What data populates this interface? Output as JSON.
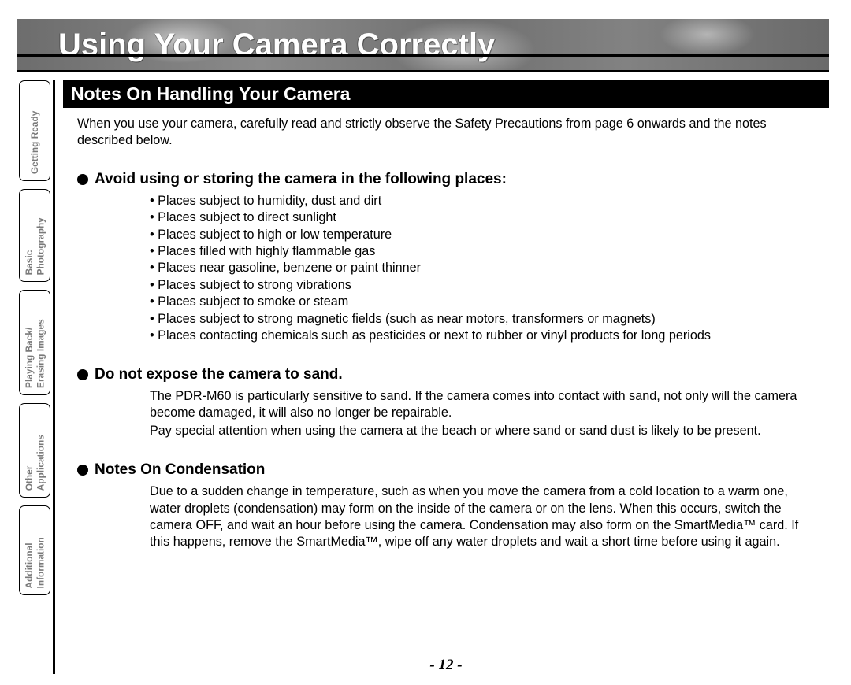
{
  "title": "Using Your Camera Correctly",
  "section_header": "Notes On Handling Your Camera",
  "intro": "When you use your camera, carefully read and strictly observe the Safety Precautions from page 6 onwards and the notes described below.",
  "sub1": {
    "heading": "Avoid using or storing the camera in the following places:",
    "items": [
      "Places subject to humidity, dust and dirt",
      "Places subject to direct sunlight",
      "Places subject to high or low temperature",
      "Places filled with highly flammable gas",
      "Places near gasoline, benzene or paint thinner",
      "Places subject to strong vibrations",
      "Places subject to smoke or steam",
      "Places subject to strong magnetic fields (such as near motors, transformers or magnets)",
      "Places contacting chemicals such as pesticides or next to rubber or vinyl products for long periods"
    ]
  },
  "sub2": {
    "heading": "Do not expose the camera to sand.",
    "para1": "The PDR-M60 is particularly sensitive to sand. If the camera comes into contact with sand, not only will the camera become damaged, it will also no longer be repairable.",
    "para2": "Pay special attention when using the camera at the beach or where sand or sand dust is likely to be present."
  },
  "sub3": {
    "heading": "Notes On Condensation",
    "para1": "Due to a sudden change in temperature, such as when you move the camera from a cold location to a warm one, water droplets (condensation) may form on the inside of the camera or on the lens. When this occurs, switch the camera OFF, and wait an hour before using the camera. Condensation may also form on the SmartMedia™ card. If this happens, remove the SmartMedia™, wipe off any water droplets and wait a short time before using it again."
  },
  "page_number": "- 12 -",
  "tabs": {
    "t1": "Getting Ready",
    "t2a": "Basic",
    "t2b": "Photography",
    "t3a": "Playing Back/",
    "t3b": "Erasing Images",
    "t4a": "Other",
    "t4b": "Applications",
    "t5a": "Additional",
    "t5b": "Information"
  }
}
